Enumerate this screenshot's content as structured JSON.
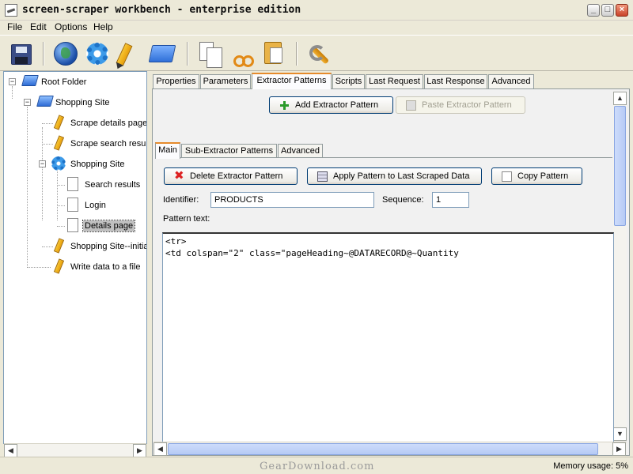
{
  "window": {
    "title": "screen-scraper workbench - enterprise edition",
    "controls": {
      "minimize": "_",
      "maximize": "□",
      "close": "×"
    }
  },
  "menu": [
    "File",
    "Edit",
    "Options",
    "Help"
  ],
  "toolbar": {
    "buttons": [
      "save-icon",
      "globe-icon",
      "gear-icon",
      "pencil-icon",
      "folder-icon",
      "copy-icon",
      "cut-icon",
      "paste-icon",
      "wrench-icon"
    ]
  },
  "tree": {
    "root": "Root Folder",
    "shopping_site_folder": "Shopping Site",
    "scrape_details": "Scrape details page",
    "scrape_search": "Scrape search results",
    "shopping_site_session": "Shopping Site",
    "search_results": "Search results",
    "login": "Login",
    "details_page": "Details page",
    "shopping_site_initial": "Shopping Site--initial",
    "write_data": "Write data to a file"
  },
  "tabs": [
    "Properties",
    "Parameters",
    "Extractor Patterns",
    "Scripts",
    "Last Request",
    "Last Response",
    "Advanced"
  ],
  "active_tab": "Extractor Patterns",
  "buttons": {
    "add_pattern": "Add Extractor Pattern",
    "paste_pattern": "Paste Extractor Pattern",
    "delete_pattern": "Delete Extractor Pattern",
    "apply_pattern": "Apply Pattern to Last Scraped Data",
    "copy_pattern": "Copy Pattern"
  },
  "sub_tabs": [
    "Main",
    "Sub-Extractor Patterns",
    "Advanced"
  ],
  "form": {
    "identifier_label": "Identifier:",
    "identifier_value": "PRODUCTS",
    "sequence_label": "Sequence:",
    "sequence_value": "1",
    "pattern_text_label": "Pattern text:",
    "pattern_text": "<tr>\n<td colspan=\"2\" class=\"pageHeading~@DATARECORD@~Quantity"
  },
  "status": {
    "memory": "Memory usage: 5%",
    "watermark": "GearDownload.com"
  },
  "scroll": {
    "left": "◀",
    "right": "▶",
    "up": "▲",
    "down": "▼"
  }
}
